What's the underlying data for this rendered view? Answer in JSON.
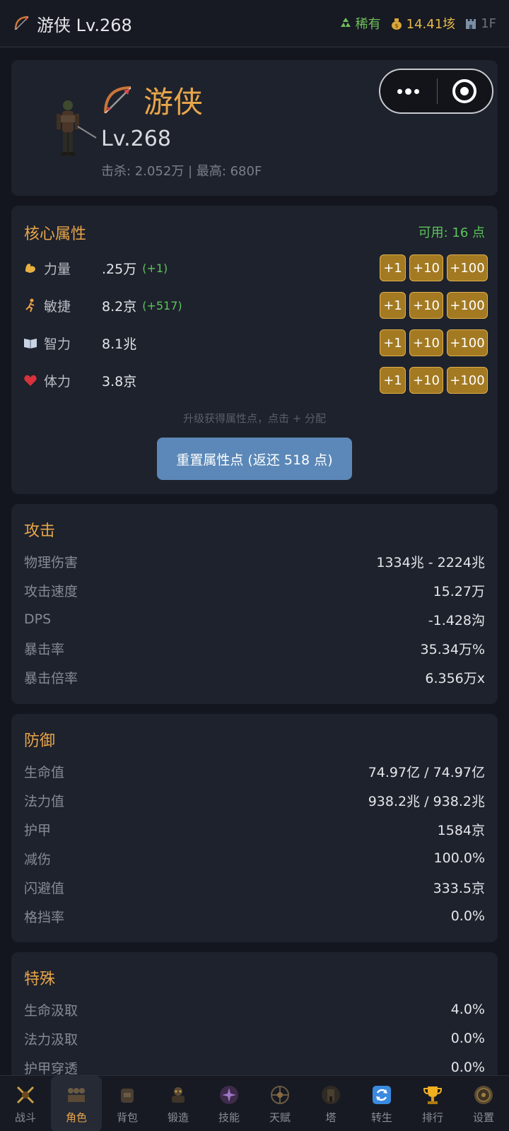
{
  "topbar": {
    "class_name": "游侠",
    "level": "Lv.268",
    "rarity": "稀有",
    "gold": "14.41垓",
    "floor": "1F"
  },
  "hero": {
    "name": "游侠",
    "level": "Lv.268",
    "stats_line": "击杀: 2.052万 | 最高: 680F"
  },
  "core": {
    "title": "核心属性",
    "available": "可用: 16 点",
    "attributes": [
      {
        "icon": "muscle-icon",
        "name": "力量",
        "value": ".25万",
        "bonus": "(+1)"
      },
      {
        "icon": "runner-icon",
        "name": "敏捷",
        "value": "8.2京",
        "bonus": "(+517)"
      },
      {
        "icon": "book-icon",
        "name": "智力",
        "value": "8.1兆",
        "bonus": ""
      },
      {
        "icon": "heart-icon",
        "name": "体力",
        "value": "3.8京",
        "bonus": ""
      }
    ],
    "btn_labels": [
      "+1",
      "+10",
      "+100"
    ],
    "hint": "升级获得属性点，点击 + 分配",
    "reset_label": "重置属性点 (返还 518 点)"
  },
  "attack": {
    "title": "攻击",
    "rows": [
      {
        "k": "物理伤害",
        "v": "1334兆 - 2224兆"
      },
      {
        "k": "攻击速度",
        "v": "15.27万"
      },
      {
        "k": "DPS",
        "v": "-1.428沟"
      },
      {
        "k": "暴击率",
        "v": "35.34万%"
      },
      {
        "k": "暴击倍率",
        "v": "6.356万x"
      }
    ]
  },
  "defense": {
    "title": "防御",
    "rows": [
      {
        "k": "生命值",
        "v": "74.97亿 / 74.97亿"
      },
      {
        "k": "法力值",
        "v": "938.2兆 / 938.2兆"
      },
      {
        "k": "护甲",
        "v": "1584京"
      },
      {
        "k": "减伤",
        "v": "100.0%"
      },
      {
        "k": "闪避值",
        "v": "333.5京"
      },
      {
        "k": "格挡率",
        "v": "0.0%"
      }
    ]
  },
  "special": {
    "title": "特殊",
    "rows": [
      {
        "k": "生命汲取",
        "v": "4.0%"
      },
      {
        "k": "法力汲取",
        "v": "0.0%"
      },
      {
        "k": "护甲穿透",
        "v": "0.0%"
      }
    ]
  },
  "nav": [
    {
      "label": "战斗",
      "icon": "crossed-swords-icon"
    },
    {
      "label": "角色",
      "icon": "character-icon"
    },
    {
      "label": "背包",
      "icon": "backpack-icon"
    },
    {
      "label": "锻造",
      "icon": "anvil-icon"
    },
    {
      "label": "技能",
      "icon": "skill-icon"
    },
    {
      "label": "天赋",
      "icon": "talent-icon"
    },
    {
      "label": "塔",
      "icon": "tower-icon"
    },
    {
      "label": "转生",
      "icon": "rebirth-icon"
    },
    {
      "label": "排行",
      "icon": "trophy-icon"
    },
    {
      "label": "设置",
      "icon": "settings-icon"
    }
  ],
  "colors": {
    "accent": "#e8a54a",
    "positive": "#5cc45c",
    "button_gold": "#a37a22",
    "reset_blue": "#5b88b8"
  }
}
